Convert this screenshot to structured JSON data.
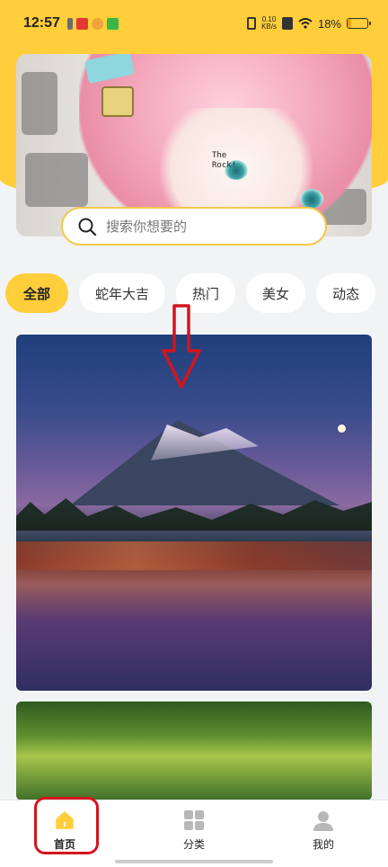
{
  "status_bar": {
    "time": "12:57",
    "net_speed_value": "0.10",
    "net_speed_unit": "KB/s",
    "battery": "18%",
    "battery_level": 0.18
  },
  "banner": {
    "caption_line1": "The",
    "caption_line2": "Rock!"
  },
  "search": {
    "placeholder": "搜索你想要的"
  },
  "tabs": [
    "全部",
    "蛇年大吉",
    "热门",
    "美女",
    "动态"
  ],
  "bottom_nav": {
    "home": "首页",
    "category": "分类",
    "mine": "我的"
  },
  "colors": {
    "accent": "#ffce3a",
    "annotation": "#d4141d"
  }
}
